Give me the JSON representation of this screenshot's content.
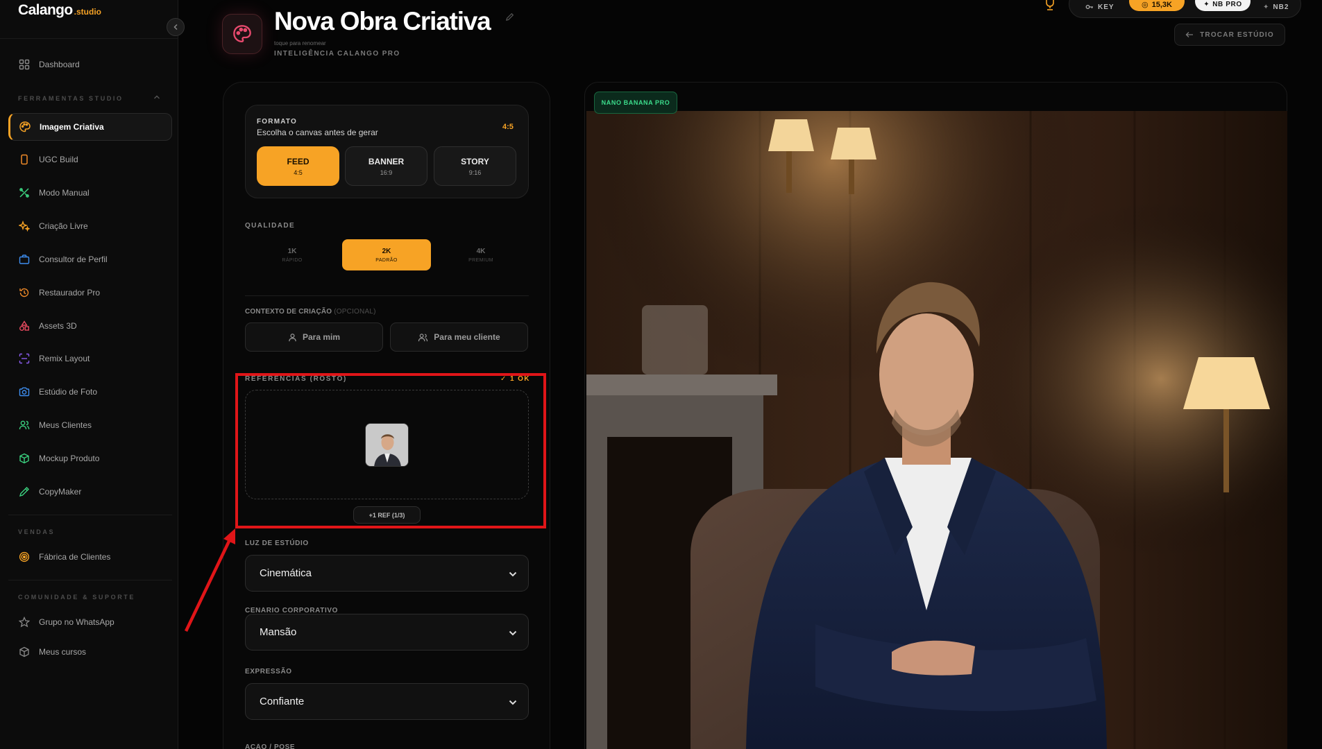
{
  "brand": {
    "name": "Calango",
    "suffix": ".studio"
  },
  "sidebar": {
    "dashboard": "Dashboard",
    "sections": {
      "tools": "FERRAMENTAS STUDIO",
      "sales": "VENDAS",
      "community": "COMUNIDADE & SUPORTE"
    },
    "tools": [
      {
        "label": "Imagem Criativa",
        "icon": "palette-icon",
        "active": true
      },
      {
        "label": "UGC Build",
        "icon": "smartphone-icon"
      },
      {
        "label": "Modo Manual",
        "icon": "tools-icon"
      },
      {
        "label": "Criação Livre",
        "icon": "sparkles-icon"
      },
      {
        "label": "Consultor de Perfil",
        "icon": "briefcase-icon"
      },
      {
        "label": "Restaurador Pro",
        "icon": "history-icon"
      },
      {
        "label": "Assets 3D",
        "icon": "shapes-icon"
      },
      {
        "label": "Remix Layout",
        "icon": "scan-icon"
      },
      {
        "label": "Estúdio de Foto",
        "icon": "camera-icon"
      },
      {
        "label": "Meus Clientes",
        "icon": "users-icon"
      },
      {
        "label": "Mockup Produto",
        "icon": "package-icon"
      },
      {
        "label": "CopyMaker",
        "icon": "pen-icon"
      }
    ],
    "sales": [
      {
        "label": "Fábrica de Clientes",
        "icon": "target-icon"
      }
    ],
    "community": [
      {
        "label": "Grupo no WhatsApp",
        "icon": "star-icon"
      },
      {
        "label": "Meus cursos",
        "icon": "box-icon"
      }
    ]
  },
  "header": {
    "title": "Nova Obra Criativa",
    "rename_hint": "toque para renomear",
    "subtitle": "INTELIGÊNCIA CALANGO PRO"
  },
  "topbar": {
    "key": "KEY",
    "coins": "15,3K",
    "nb_pro": "NB PRO",
    "nb2": "NB2",
    "switch_studio": "TROCAR ESTÚDIO"
  },
  "format": {
    "label": "FORMATO",
    "subtitle": "Escolha o canvas antes de gerar",
    "current_ratio": "4:5",
    "options": [
      {
        "name": "FEED",
        "ratio": "4:5",
        "active": true
      },
      {
        "name": "BANNER",
        "ratio": "16:9"
      },
      {
        "name": "STORY",
        "ratio": "9:16"
      }
    ]
  },
  "quality": {
    "label": "QUALIDADE",
    "options": [
      {
        "name": "1K",
        "desc": "RÁPIDO"
      },
      {
        "name": "2K",
        "desc": "PADRÃO",
        "active": true
      },
      {
        "name": "4K",
        "desc": "PREMIUM"
      }
    ]
  },
  "context": {
    "label": "CONTEXTO DE CRIAÇÃO",
    "optional": "(OPCIONAL)",
    "for_me": "Para mim",
    "for_client": "Para meu cliente"
  },
  "references": {
    "label": "REFERENCIAS (ROSTO)",
    "status": "✓ 1 OK",
    "add_button": "+1 REF (1/3)"
  },
  "fields": {
    "light": {
      "label": "LUZ DE ESTÚDIO",
      "value": "Cinemática"
    },
    "scenario": {
      "label": "CENÁRIO CORPORATIVO",
      "value": "Mansão"
    },
    "expression": {
      "label": "EXPRESSÃO",
      "value": "Confiante"
    },
    "next_label": "AÇÃO / POSE"
  },
  "preview": {
    "model_badge": "NANO BANANA PRO"
  },
  "colors": {
    "accent": "#f7a325",
    "highlight": "#e01518",
    "badge_green": "#3cdd8c"
  }
}
